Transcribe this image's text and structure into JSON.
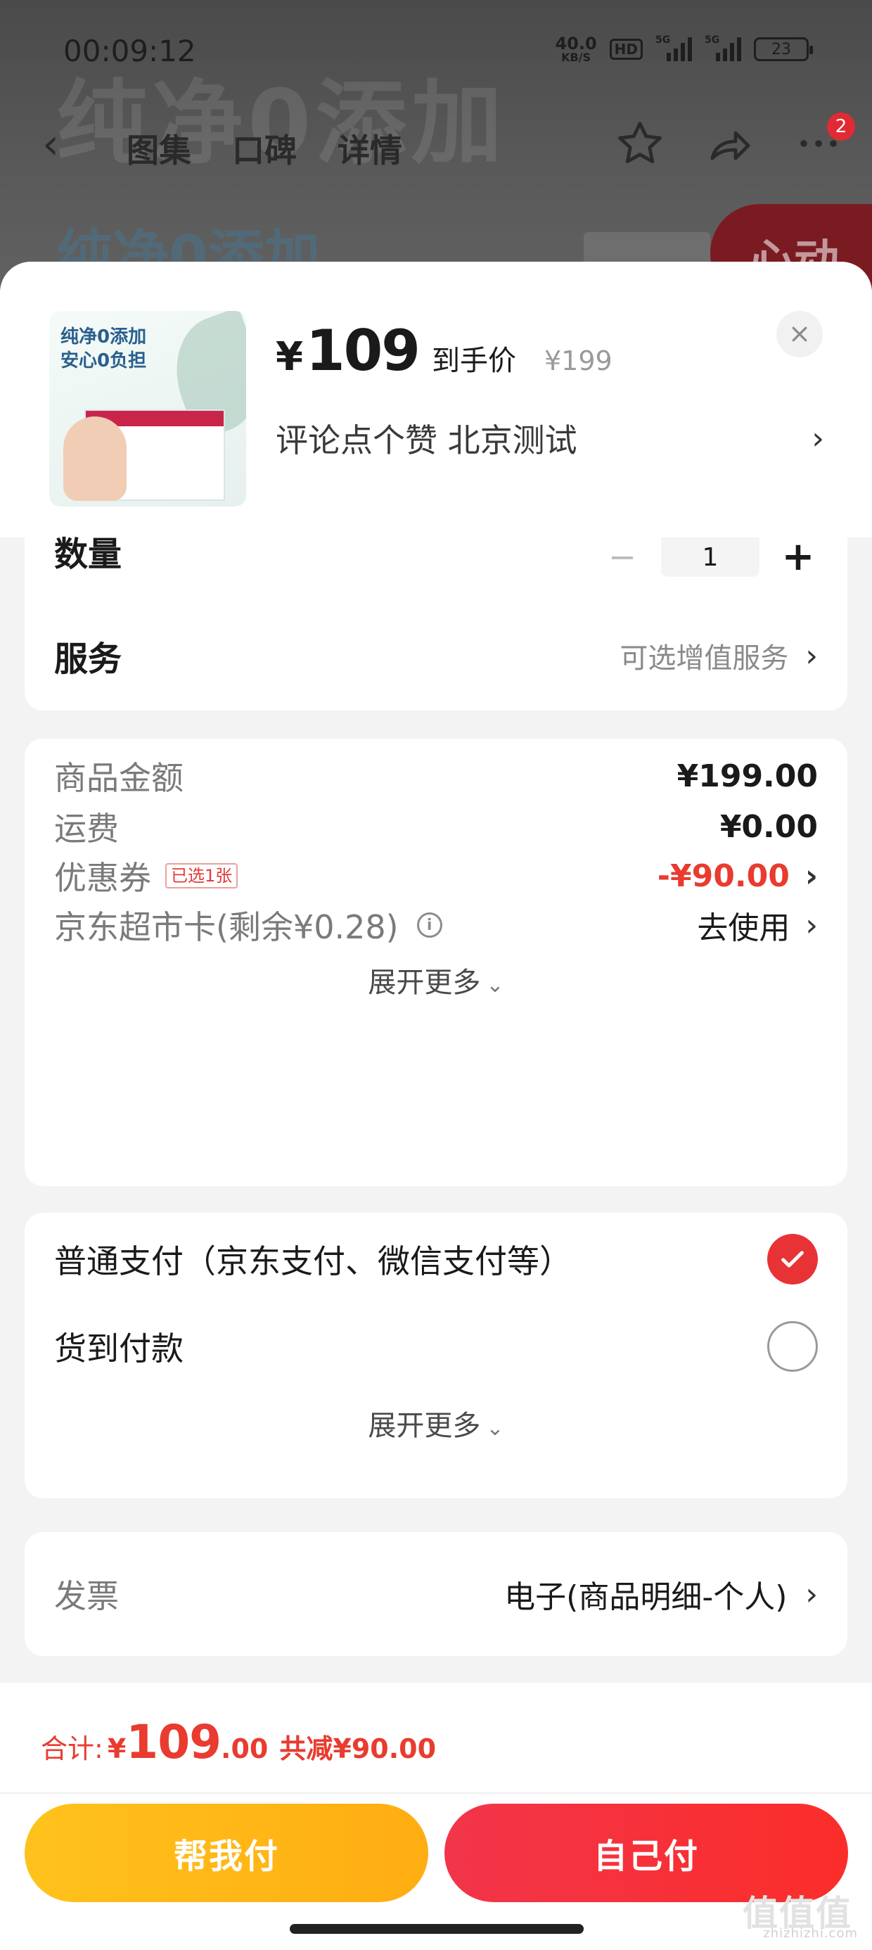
{
  "status_bar": {
    "time": "00:09:12",
    "net_speed_value": "40.0",
    "net_speed_unit": "KB/S",
    "hd_label": "HD",
    "sig1_label": "5G",
    "sig2_label": "5G",
    "battery": "23"
  },
  "background_page": {
    "ghost_text": "纯净0添加",
    "ghost_text2": "纯净0添加",
    "promo_partial": "心动",
    "tabs": [
      "图集",
      "口碑",
      "详情"
    ],
    "badge_count": "2"
  },
  "product": {
    "thumb_line1": "纯净0添加",
    "thumb_line2": "安心0负担",
    "price_symbol": "¥",
    "price": "109",
    "price_tag": "到手价",
    "original_price": "¥199",
    "spec_text": "评论点个赞  北京测试"
  },
  "quantity": {
    "label": "数量",
    "value": "1",
    "minus": "−",
    "plus": "+"
  },
  "service": {
    "label": "服务",
    "value": "可选增值服务"
  },
  "fees": {
    "goods_label": "商品金额",
    "goods_value": "¥199.00",
    "shipping_label": "运费",
    "shipping_value": "¥0.00",
    "coupon_label": "优惠券",
    "coupon_tag": "已选1张",
    "coupon_value": "-¥90.00",
    "card_label": "京东超市卡(剩余¥0.28)",
    "card_info": "i",
    "card_value": "去使用",
    "expand_label": "展开更多"
  },
  "payment": {
    "option1": "普通支付（京东支付、微信支付等）",
    "option2": "货到付款",
    "expand_label": "展开更多"
  },
  "invoice": {
    "label": "发票",
    "value": "电子(商品明细-个人)"
  },
  "summary": {
    "total_label": "合计:",
    "total_yen": "¥",
    "total_int": "109",
    "total_dec": ".00",
    "saving": "共减¥90.00"
  },
  "actions": {
    "help_pay": "帮我付",
    "self_pay": "自己付"
  },
  "watermark": {
    "logo": "值值值",
    "domain": "zhizhizhi.com"
  },
  "colors": {
    "accent_red": "#e93b2f",
    "help_button": "#ffb816",
    "self_button": "#f7313a"
  }
}
